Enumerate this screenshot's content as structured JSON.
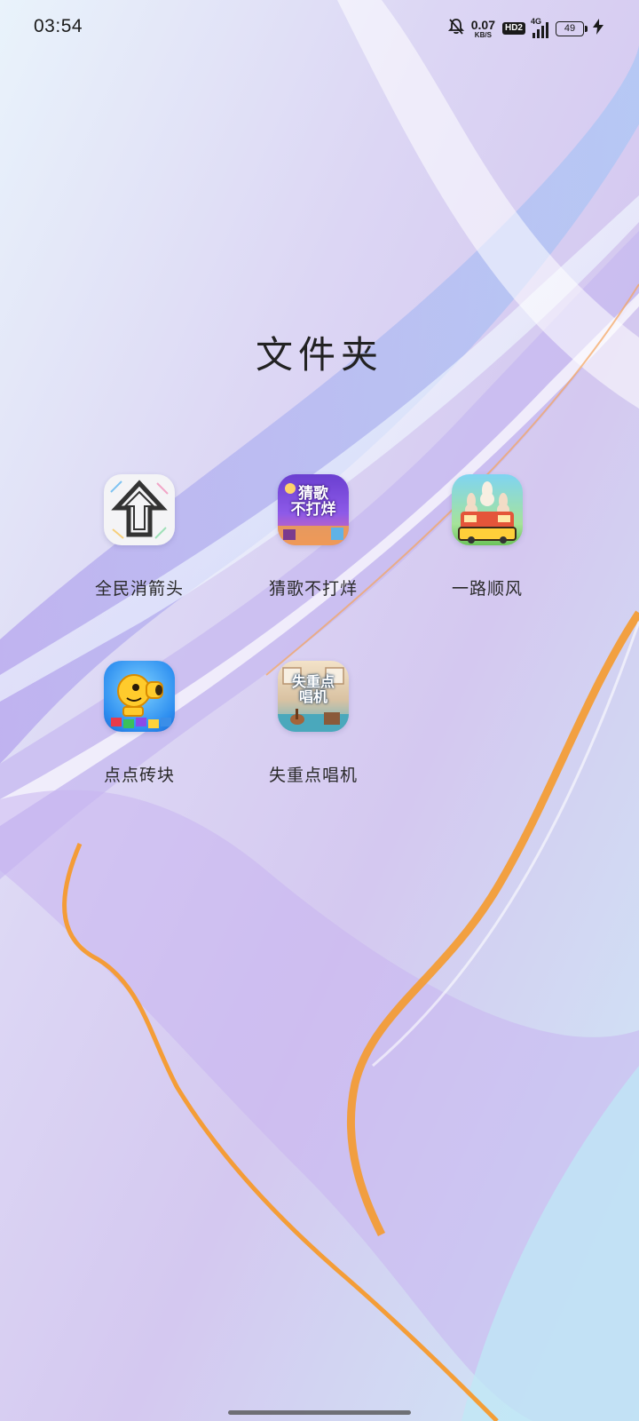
{
  "status_bar": {
    "time": "03:54",
    "net_speed_value": "0.07",
    "net_speed_unit": "KB/S",
    "hd_badge": "HD2",
    "network_type": "4G",
    "battery_level": "49",
    "icons": [
      "bell-off-icon",
      "signal-bars-icon",
      "battery-icon",
      "charging-bolt-icon"
    ]
  },
  "folder": {
    "title": "文件夹",
    "apps": [
      {
        "label": "全民消箭头",
        "icon": "arrow-up-icon"
      },
      {
        "label": "猜歌不打烊",
        "icon": "guess-song-icon",
        "icon_text": [
          "猜歌",
          "不打烊"
        ]
      },
      {
        "label": "一路顺风",
        "icon": "bunny-bus-icon"
      },
      {
        "label": "点点砖块",
        "icon": "peashooter-blocks-icon"
      },
      {
        "label": "失重点唱机",
        "icon": "jukebox-icon",
        "icon_text": [
          "失重点",
          "唱机"
        ]
      }
    ]
  },
  "colors": {
    "accent_orange": "#f59a2c",
    "wallpaper_lilac": "#d8c8f2",
    "wallpaper_sky": "#cfe6f6"
  }
}
